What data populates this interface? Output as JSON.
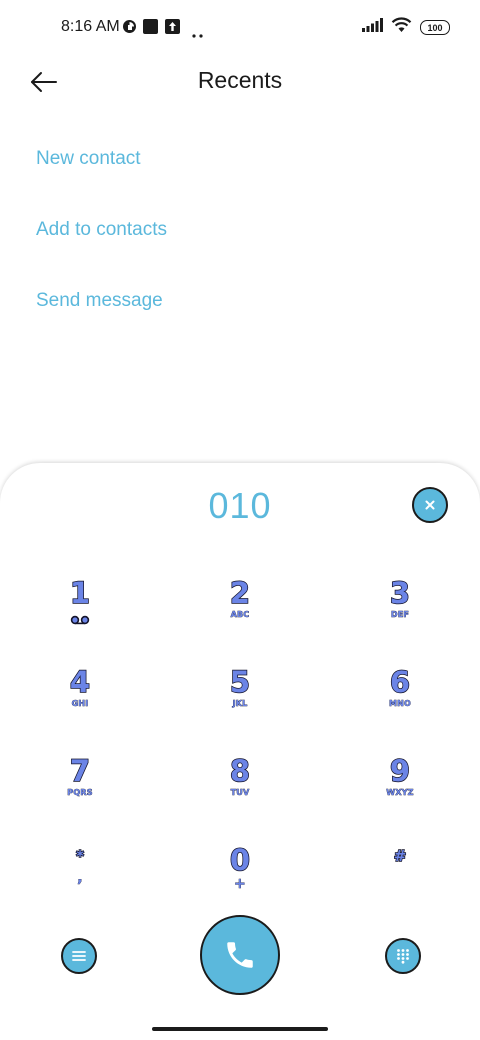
{
  "status_bar": {
    "time": "8:16 AM",
    "battery": "100",
    "icons": [
      "vpn-icon",
      "stop-icon",
      "upload-icon",
      "more-dots-icon",
      "signal-icon",
      "wifi-icon",
      "battery-icon"
    ]
  },
  "header": {
    "title": "Recents",
    "back_icon": "arrow-left-icon"
  },
  "actions": {
    "new_contact": "New contact",
    "add_to_contacts": "Add to contacts",
    "send_message": "Send message"
  },
  "dialer": {
    "number": "010",
    "keys": [
      {
        "digit": "1",
        "letters": "voicemail-icon"
      },
      {
        "digit": "2",
        "letters": "ABC"
      },
      {
        "digit": "3",
        "letters": "DEF"
      },
      {
        "digit": "4",
        "letters": "GHI"
      },
      {
        "digit": "5",
        "letters": "JKL"
      },
      {
        "digit": "6",
        "letters": "MNO"
      },
      {
        "digit": "7",
        "letters": "PQRS"
      },
      {
        "digit": "8",
        "letters": "TUV"
      },
      {
        "digit": "9",
        "letters": "WXYZ"
      },
      {
        "digit": "*",
        "letters": ","
      },
      {
        "digit": "0",
        "letters": "+"
      },
      {
        "digit": "#",
        "letters": ""
      }
    ]
  },
  "colors": {
    "accent": "#5bb8dc",
    "key_fill": "#6b84e6",
    "outline": "#14142b",
    "text": "#1b1b1b"
  }
}
